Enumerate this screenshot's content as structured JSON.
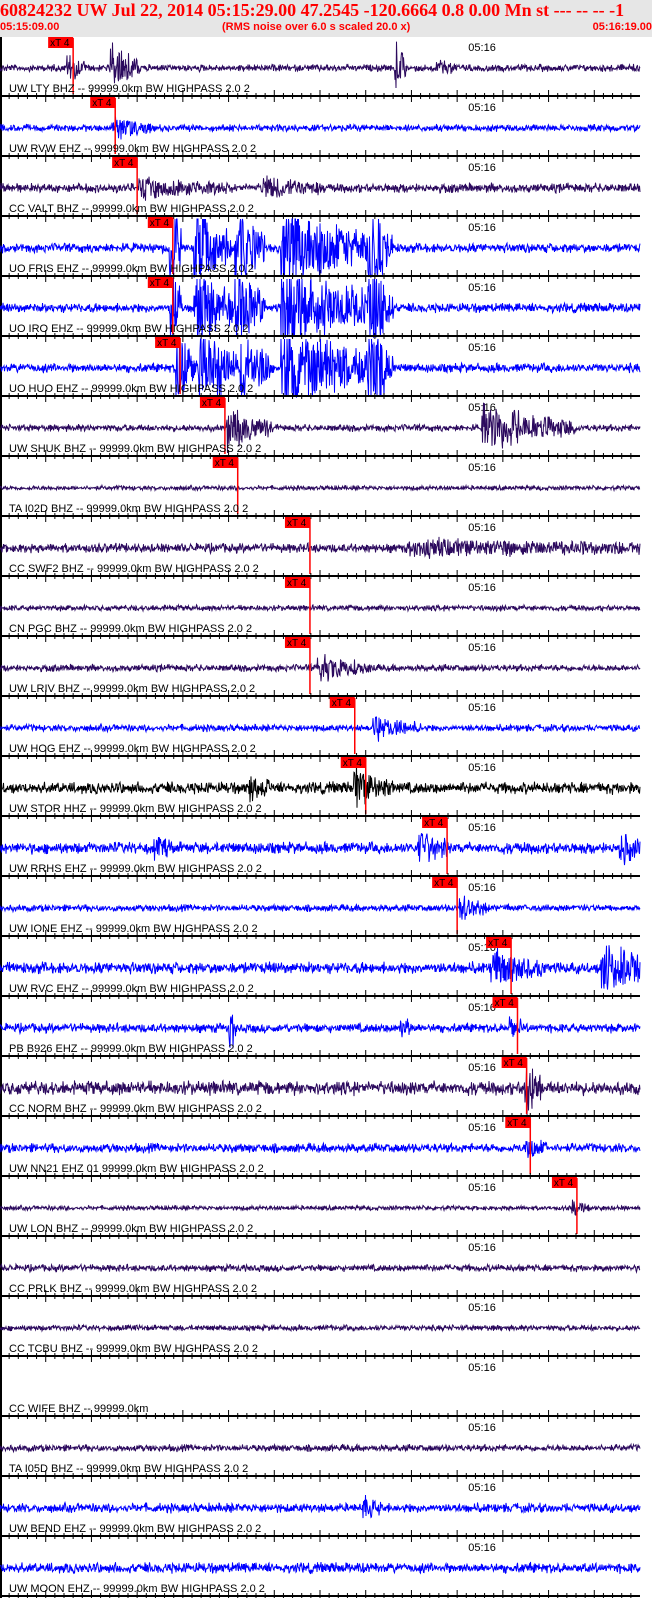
{
  "header": {
    "title": "60824232 UW Jul 22, 2014 05:15:29.00    47.2545 -120.6664  0.8 0.00 Mn st --- -- --   -1",
    "start_time": "05:15:09.00",
    "note": "(RMS noise over 6.0 s scaled 20.0 x)",
    "end_time": "05:16:19.00"
  },
  "chart_data": {
    "type": "line",
    "title": "Seismogram record section",
    "x_range_seconds": [
      0,
      70
    ],
    "minute_mark": {
      "label": "05:16",
      "t": 51
    },
    "pick_label": "xT 4",
    "colors": {
      "purple": "#2c0a5e",
      "blue": "#0000ff",
      "black": "#000000",
      "pick": "#ff0000"
    },
    "traces": [
      {
        "label": "UW LTY BHZ -- 99999.0km BW  HIGHPASS  2.0  2",
        "color": "purple",
        "noise": 3,
        "pick": 8.0,
        "events": [
          [
            7.5,
            18,
            2
          ],
          [
            12.3,
            28,
            3
          ],
          [
            43.5,
            30,
            1
          ],
          [
            48,
            8,
            2
          ]
        ]
      },
      {
        "label": "UW RVW EHZ -- 99999.0km BW  HIGHPASS  2.0  2",
        "color": "blue",
        "noise": 3,
        "pick": 12.6,
        "events": [
          [
            12.5,
            14,
            4
          ]
        ]
      },
      {
        "label": "CC VALT BHZ -- 99999.0km BW  HIGHPASS  2.0  2",
        "color": "purple",
        "noise": 4,
        "pick": 15.0,
        "events": [
          [
            15.5,
            10,
            10
          ],
          [
            29,
            12,
            6
          ]
        ]
      },
      {
        "label": "UO FRIS EHZ -- 99999.0km BW  HIGHPASS  2.0  2",
        "color": "blue",
        "noise": 4,
        "pick": 18.9,
        "events": [
          [
            18.8,
            60,
            1
          ],
          [
            21.5,
            60,
            4
          ],
          [
            26,
            60,
            3
          ],
          [
            31,
            60,
            11
          ],
          [
            40.5,
            60,
            2.5
          ]
        ]
      },
      {
        "label": "UO IRO EHZ -- 99999.0km BW  HIGHPASS  2.0  2",
        "color": "blue",
        "noise": 4,
        "pick": 18.9,
        "events": [
          [
            18.8,
            60,
            1
          ],
          [
            21.5,
            60,
            4
          ],
          [
            26,
            60,
            3
          ],
          [
            31,
            60,
            11
          ],
          [
            40.5,
            60,
            2.5
          ]
        ]
      },
      {
        "label": "UO HUO EHZ -- 99999.0km BW  HIGHPASS  2.0  2",
        "color": "blue",
        "noise": 4,
        "pick": 19.7,
        "events": [
          [
            19.5,
            60,
            2
          ],
          [
            22,
            60,
            4
          ],
          [
            26.5,
            60,
            3
          ],
          [
            31,
            60,
            11
          ],
          [
            40.5,
            60,
            2.5
          ]
        ]
      },
      {
        "label": "UW SHUK BHZ -- 99999.0km BW  HIGHPASS  2.0  2",
        "color": "purple",
        "noise": 3,
        "pick": 24.6,
        "events": [
          [
            25,
            25,
            5
          ],
          [
            53,
            30,
            10
          ]
        ]
      },
      {
        "label": "TA I02D BHZ -- 99999.0km BW  HIGHPASS  2.0  2",
        "color": "purple",
        "noise": 2,
        "pick": 26.0,
        "events": []
      },
      {
        "label": "CC SWF2 BHZ -- 99999.0km BW  HIGHPASS  2.0  2",
        "color": "purple",
        "noise": 4,
        "pick": 33.9,
        "events": [
          [
            45,
            7,
            50
          ]
        ]
      },
      {
        "label": "CN PGC BHZ -- 99999.0km BW  HIGHPASS  2.0  2",
        "color": "purple",
        "noise": 2.5,
        "pick": 33.9,
        "events": []
      },
      {
        "label": "UW LRIV BHZ -- 99999.0km BW  HIGHPASS  2.0  2",
        "color": "purple",
        "noise": 3,
        "pick": 33.9,
        "events": [
          [
            35,
            15,
            6
          ]
        ]
      },
      {
        "label": "UW HOG EHZ -- 99999.0km BW  HIGHPASS  2.0  2",
        "color": "blue",
        "noise": 3,
        "pick": 38.8,
        "events": [
          [
            41,
            14,
            5
          ]
        ]
      },
      {
        "label": "UW STOR HHZ -- 99999.0km BW  HIGHPASS  2.0  2",
        "color": "black",
        "noise": 5,
        "pick": 40.0,
        "events": [
          [
            27.5,
            14,
            2
          ],
          [
            39,
            22,
            4
          ]
        ]
      },
      {
        "label": "UW RRHS EHZ -- 99999.0km BW  HIGHPASS  2.0  2",
        "color": "blue",
        "noise": 5,
        "pick": 48.9,
        "events": [
          [
            17,
            10,
            2
          ],
          [
            46,
            20,
            3
          ],
          [
            68,
            15,
            3
          ]
        ]
      },
      {
        "label": "UW IONE EHZ -- 99999.0km BW  HIGHPASS  2.0  2",
        "color": "blue",
        "noise": 3,
        "pick": 50.0,
        "events": [
          [
            50.5,
            14,
            3
          ]
        ]
      },
      {
        "label": "UW RVC EHZ -- 99999.0km BW  HIGHPASS  2.0  2",
        "color": "blue",
        "noise": 5,
        "pick": 55.9,
        "events": [
          [
            54,
            20,
            6
          ],
          [
            66,
            28,
            8
          ]
        ]
      },
      {
        "label": "PB B926 EHZ -- 99999.0km BW  HIGHPASS  2.0  2",
        "color": "blue",
        "noise": 4,
        "pick": 56.6,
        "events": [
          [
            25.3,
            30,
            0.5
          ],
          [
            44,
            15,
            1
          ],
          [
            56,
            14,
            1
          ]
        ]
      },
      {
        "label": "CC NORM BHZ -- 99999.0km BW  HIGHPASS  2.0  2",
        "color": "purple",
        "noise": 6,
        "pick": 57.6,
        "events": [
          [
            57.7,
            40,
            1.5
          ]
        ]
      },
      {
        "label": "UW NN21 EHZ 01 99999.0km BW  HIGHPASS  2.0  2",
        "color": "blue",
        "noise": 4,
        "pick": 58.0,
        "events": [
          [
            57.8,
            12,
            2
          ]
        ]
      },
      {
        "label": "UW LON BHZ -- 99999.0km BW  HIGHPASS  2.0  2",
        "color": "purple",
        "noise": 2,
        "pick": 63.1,
        "events": [
          [
            62.8,
            8,
            2
          ]
        ]
      },
      {
        "label": "CC PRLK BHZ -- 99999.0km BW  HIGHPASS  2.0  2",
        "color": "purple",
        "noise": 3,
        "pick": null,
        "events": []
      },
      {
        "label": "CC TCBU BHZ -- 99999.0km BW  HIGHPASS  2.0  2",
        "color": "purple",
        "noise": 2.5,
        "pick": null,
        "events": []
      },
      {
        "label": "CC WIFE BHZ -- 99999.0km",
        "color": "purple",
        "noise": 0,
        "pick": null,
        "events": []
      },
      {
        "label": "TA I05D BHZ -- 99999.0km BW  HIGHPASS  2.0  2",
        "color": "purple",
        "noise": 3,
        "pick": null,
        "events": []
      },
      {
        "label": "UW BEND EHZ -- 99999.0km BW  HIGHPASS  2.0  2",
        "color": "blue",
        "noise": 4,
        "pick": null,
        "events": [
          [
            40,
            10,
            2
          ]
        ]
      },
      {
        "label": "UW MOON EHZ -- 99999.0km BW  HIGHPASS  2.0  2",
        "color": "blue",
        "noise": 4.5,
        "pick": null,
        "events": []
      }
    ]
  }
}
